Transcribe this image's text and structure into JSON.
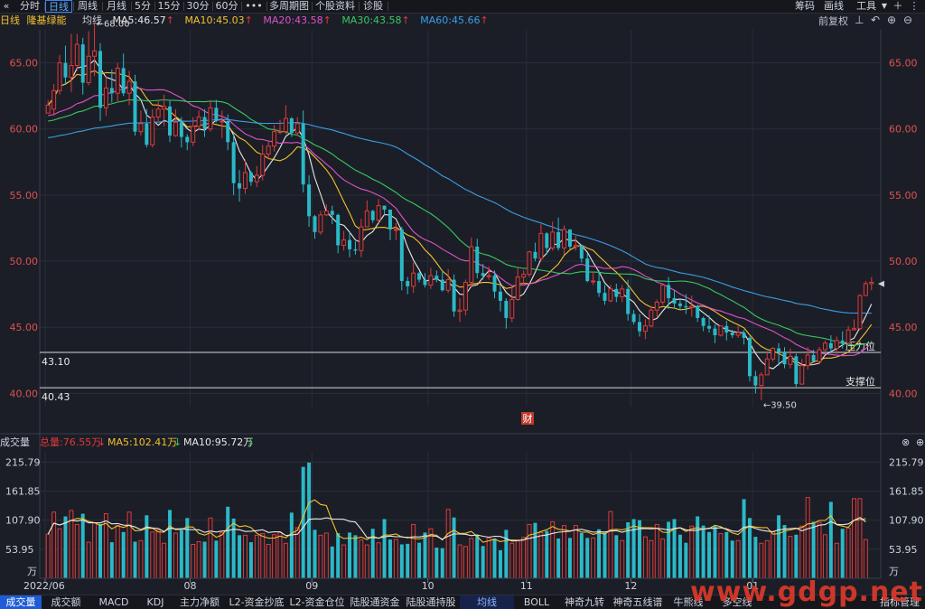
{
  "toolbar": {
    "back_icon": "«",
    "tabs": [
      "分时",
      "日线",
      "周线",
      "月线",
      "5分",
      "15分",
      "30分",
      "60分",
      "•••",
      "多周期图",
      "个股资料",
      "诊股"
    ],
    "active_tab": "日线",
    "right": [
      "筹码",
      "画线",
      "工具"
    ]
  },
  "ma_row": {
    "period": "日线",
    "stock": "隆基绿能",
    "label": "均线",
    "ma5": "MA5:46.57",
    "ma10": "MA10:45.03",
    "ma20": "MA20:43.58",
    "ma30": "MA30:43.58",
    "ma60": "MA60:45.66",
    "adjust": "前复权"
  },
  "colors": {
    "up": "#e03a3a",
    "down": "#2bb9c8",
    "ma5": "#e8e8e8",
    "ma10": "#f2c12e",
    "ma20": "#e052c8",
    "ma30": "#39c860",
    "ma60": "#3a9ee8",
    "bg": "#1b1e27"
  },
  "annotations": {
    "high": "68.00",
    "low": "39.50",
    "line1_value": "43.10",
    "line1_label": "压力位",
    "line2_value": "40.43",
    "line2_label": "支撑位",
    "fin_marker": "财"
  },
  "volume": {
    "title": "成交量",
    "total": "总量:76.55万",
    "ma5": "MA5:102.41万",
    "ma10": "MA10:95.72万",
    "y_ticks": [
      "215.79",
      "161.85",
      "107.90",
      "53.95",
      "万"
    ]
  },
  "bottom_tabs": [
    "成交量",
    "成交额",
    "MACD",
    "KDJ",
    "主力净额",
    "L2-资金抄底",
    "L2-资金仓位",
    "陆股通资金",
    "陆股通持股",
    "均线",
    "BOLL",
    "神奇九转",
    "神奇五线谱",
    "牛熊线",
    "多空线",
    "指标管理"
  ],
  "watermark": "www.gdgp.net",
  "chart_data": {
    "type": "candlestick",
    "price_axis": {
      "ticks": [
        40,
        45,
        50,
        55,
        60,
        65
      ],
      "tick_labels": [
        "40.00",
        "45.00",
        "50.00",
        "55.00",
        "60.00",
        "65.00"
      ],
      "ylim": [
        39.0,
        67.5
      ]
    },
    "x_labels": [
      "2022/06",
      "08",
      "09",
      "10",
      "11",
      "12",
      "01"
    ],
    "month_starts_index": [
      0,
      25,
      46,
      66,
      83,
      101,
      122
    ],
    "candles": [
      [
        61.2,
        61.8,
        61.5,
        62.2
      ],
      [
        61.5,
        62.9,
        61.0,
        63.4
      ],
      [
        62.9,
        65.0,
        62.6,
        65.6
      ],
      [
        65.0,
        63.9,
        63.4,
        66.3
      ],
      [
        63.9,
        64.8,
        62.8,
        67.2
      ],
      [
        64.8,
        66.4,
        64.4,
        67.2
      ],
      [
        66.4,
        63.5,
        62.6,
        66.9
      ],
      [
        63.5,
        65.5,
        63.3,
        67.4
      ],
      [
        65.5,
        65.9,
        64.0,
        68.0
      ],
      [
        65.9,
        61.6,
        60.6,
        66.5
      ],
      [
        61.6,
        63.1,
        61.0,
        64.0
      ],
      [
        63.1,
        62.7,
        62.0,
        64.5
      ],
      [
        62.7,
        64.6,
        62.1,
        65.0
      ],
      [
        64.6,
        62.7,
        62.5,
        65.7
      ],
      [
        62.7,
        63.6,
        61.8,
        64.4
      ],
      [
        63.6,
        59.8,
        59.5,
        64.1
      ],
      [
        59.8,
        60.4,
        59.5,
        61.4
      ],
      [
        60.4,
        58.8,
        58.6,
        61.5
      ],
      [
        58.8,
        60.9,
        58.6,
        61.5
      ],
      [
        60.9,
        61.5,
        60.6,
        62.1
      ],
      [
        61.5,
        61.7,
        60.2,
        62.6
      ],
      [
        61.7,
        59.5,
        59.0,
        62.2
      ],
      [
        59.5,
        60.5,
        59.4,
        61.5
      ],
      [
        60.5,
        59.4,
        58.6,
        60.9
      ],
      [
        59.4,
        59.0,
        58.4,
        59.6
      ],
      [
        59.0,
        60.2,
        58.7,
        60.9
      ],
      [
        60.2,
        60.9,
        59.9,
        61.4
      ],
      [
        60.9,
        60.0,
        59.4,
        61.5
      ],
      [
        60.0,
        61.6,
        59.8,
        62.2
      ],
      [
        61.6,
        60.6,
        60.5,
        62.2
      ],
      [
        60.6,
        60.6,
        59.3,
        61.4
      ],
      [
        60.6,
        59.0,
        58.4,
        61.1
      ],
      [
        59.0,
        55.9,
        55.0,
        59.7
      ],
      [
        55.9,
        55.5,
        54.5,
        56.9
      ],
      [
        55.5,
        56.7,
        55.1,
        57.7
      ],
      [
        56.7,
        56.0,
        55.7,
        56.8
      ],
      [
        56.0,
        56.5,
        55.6,
        57.2
      ],
      [
        56.5,
        58.1,
        56.1,
        58.8
      ],
      [
        58.1,
        58.7,
        57.7,
        59.1
      ],
      [
        58.7,
        59.8,
        58.3,
        60.3
      ],
      [
        59.8,
        59.8,
        59.6,
        60.7
      ],
      [
        59.8,
        60.8,
        59.6,
        61.8
      ],
      [
        60.8,
        59.7,
        59.4,
        60.9
      ],
      [
        59.7,
        60.4,
        59.5,
        60.9
      ],
      [
        60.4,
        55.8,
        55.2,
        61.4
      ],
      [
        55.8,
        53.4,
        52.6,
        56.5
      ],
      [
        53.4,
        52.2,
        51.7,
        53.5
      ],
      [
        52.2,
        53.5,
        52.0,
        53.8
      ],
      [
        53.5,
        53.8,
        53.4,
        54.3
      ],
      [
        53.8,
        53.5,
        52.8,
        54.2
      ],
      [
        53.5,
        51.2,
        50.6,
        53.6
      ],
      [
        51.2,
        51.6,
        50.8,
        52.3
      ],
      [
        51.6,
        50.9,
        50.3,
        52.2
      ],
      [
        50.9,
        50.8,
        50.5,
        51.5
      ],
      [
        50.8,
        52.6,
        50.3,
        53.2
      ],
      [
        52.6,
        53.8,
        52.6,
        54.6
      ],
      [
        53.8,
        53.1,
        52.9,
        53.9
      ],
      [
        53.1,
        54.2,
        52.9,
        54.7
      ],
      [
        54.2,
        53.9,
        53.5,
        54.2
      ],
      [
        53.9,
        52.4,
        51.6,
        53.9
      ],
      [
        52.4,
        52.4,
        51.6,
        52.9
      ],
      [
        52.4,
        48.5,
        47.8,
        52.6
      ],
      [
        48.5,
        48.1,
        47.5,
        48.8
      ],
      [
        48.1,
        49.1,
        47.6,
        49.9
      ],
      [
        49.1,
        48.6,
        48.4,
        49.2
      ],
      [
        48.6,
        48.2,
        48.0,
        49.1
      ],
      [
        48.2,
        48.9,
        47.9,
        49.5
      ],
      [
        48.9,
        48.6,
        48.4,
        49.3
      ],
      [
        48.6,
        47.8,
        47.7,
        49.2
      ],
      [
        47.8,
        48.6,
        47.6,
        49.4
      ],
      [
        48.6,
        46.2,
        45.8,
        49.0
      ],
      [
        46.2,
        46.3,
        45.4,
        47.2
      ],
      [
        46.3,
        48.4,
        45.9,
        48.6
      ],
      [
        48.4,
        51.1,
        48.0,
        51.8
      ],
      [
        51.1,
        49.1,
        48.7,
        51.7
      ],
      [
        49.1,
        48.9,
        48.6,
        49.8
      ],
      [
        48.9,
        48.9,
        48.6,
        49.6
      ],
      [
        48.9,
        47.7,
        47.2,
        49.3
      ],
      [
        47.7,
        47.0,
        46.2,
        48.2
      ],
      [
        47.0,
        45.7,
        44.9,
        47.2
      ],
      [
        45.7,
        47.1,
        45.4,
        48.1
      ],
      [
        47.1,
        48.8,
        47.0,
        49.5
      ],
      [
        48.8,
        49.0,
        48.2,
        49.3
      ],
      [
        49.0,
        50.7,
        48.8,
        50.8
      ],
      [
        50.7,
        50.2,
        50.0,
        51.4
      ],
      [
        50.2,
        52.1,
        50.0,
        52.8
      ],
      [
        52.1,
        51.0,
        50.5,
        52.2
      ],
      [
        51.0,
        52.2,
        50.8,
        53.0
      ],
      [
        52.2,
        51.0,
        50.8,
        53.3
      ],
      [
        51.0,
        52.4,
        50.5,
        52.7
      ],
      [
        52.4,
        51.1,
        50.9,
        52.4
      ],
      [
        51.1,
        51.2,
        50.8,
        51.9
      ],
      [
        51.2,
        50.2,
        49.9,
        51.2
      ],
      [
        50.2,
        48.5,
        48.4,
        50.6
      ],
      [
        48.5,
        48.5,
        48.2,
        49.2
      ],
      [
        48.5,
        47.6,
        47.3,
        49.3
      ],
      [
        47.6,
        47.0,
        46.7,
        48.2
      ],
      [
        47.0,
        47.9,
        46.9,
        48.2
      ],
      [
        47.9,
        47.3,
        46.9,
        48.3
      ],
      [
        47.3,
        47.9,
        46.9,
        48.2
      ],
      [
        47.9,
        46.0,
        45.5,
        48.6
      ],
      [
        46.0,
        45.4,
        45.2,
        46.3
      ],
      [
        45.4,
        44.7,
        44.3,
        46.0
      ],
      [
        44.7,
        45.1,
        44.1,
        45.6
      ],
      [
        45.1,
        46.3,
        45.0,
        46.6
      ],
      [
        46.3,
        46.9,
        45.8,
        47.1
      ],
      [
        46.9,
        48.2,
        46.7,
        48.2
      ],
      [
        48.2,
        47.2,
        46.4,
        48.8
      ],
      [
        47.2,
        46.8,
        46.4,
        47.8
      ],
      [
        46.8,
        46.6,
        46.3,
        47.2
      ],
      [
        46.6,
        46.5,
        46.0,
        47.5
      ],
      [
        46.5,
        46.6,
        45.8,
        47.4
      ],
      [
        46.6,
        45.7,
        45.4,
        46.7
      ],
      [
        45.7,
        45.1,
        44.7,
        45.8
      ],
      [
        45.1,
        44.9,
        44.6,
        45.9
      ],
      [
        44.9,
        44.4,
        43.8,
        45.2
      ],
      [
        44.4,
        45.1,
        44.3,
        45.1
      ],
      [
        45.1,
        44.6,
        44.0,
        45.5
      ],
      [
        44.6,
        44.4,
        44.2,
        44.8
      ],
      [
        44.4,
        44.6,
        44.2,
        45.1
      ],
      [
        44.6,
        44.2,
        43.7,
        44.8
      ],
      [
        44.2,
        41.3,
        40.9,
        44.3
      ],
      [
        41.3,
        40.6,
        40.0,
        41.7
      ],
      [
        40.6,
        41.4,
        39.5,
        41.6
      ],
      [
        41.4,
        42.6,
        41.4,
        43.1
      ],
      [
        42.6,
        43.4,
        42.4,
        43.5
      ],
      [
        43.4,
        43.1,
        42.1,
        43.8
      ],
      [
        43.1,
        42.2,
        41.9,
        43.5
      ],
      [
        42.2,
        42.8,
        41.9,
        43.4
      ],
      [
        42.8,
        40.7,
        40.5,
        43.0
      ],
      [
        40.7,
        42.1,
        40.7,
        42.6
      ],
      [
        42.1,
        42.9,
        41.8,
        43.5
      ],
      [
        42.9,
        42.4,
        42.4,
        43.3
      ],
      [
        42.4,
        43.3,
        42.2,
        43.5
      ],
      [
        43.3,
        43.8,
        43.2,
        44.0
      ],
      [
        43.8,
        43.4,
        43.1,
        44.4
      ],
      [
        43.4,
        44.0,
        43.0,
        44.3
      ],
      [
        44.0,
        43.8,
        43.4,
        44.7
      ],
      [
        43.8,
        44.8,
        43.8,
        45.1
      ],
      [
        44.8,
        44.9,
        44.8,
        45.6
      ],
      [
        44.9,
        47.4,
        44.8,
        47.5
      ],
      [
        47.4,
        48.3,
        47.4,
        48.5
      ],
      [
        48.3,
        48.4,
        47.8,
        48.8
      ]
    ],
    "volumes": [
      82,
      123,
      92,
      115,
      126,
      100,
      120,
      67,
      103,
      101,
      120,
      67,
      98,
      86,
      123,
      68,
      70,
      117,
      86,
      90,
      65,
      127,
      84,
      90,
      112,
      63,
      68,
      68,
      112,
      70,
      85,
      133,
      111,
      80,
      80,
      67,
      80,
      83,
      63,
      81,
      85,
      65,
      122,
      94,
      207,
      215,
      90,
      80,
      84,
      59,
      84,
      62,
      85,
      80,
      71,
      62,
      92,
      66,
      110,
      72,
      72,
      63,
      64,
      100,
      66,
      85,
      92,
      57,
      56,
      128,
      113,
      62,
      59,
      74,
      80,
      60,
      75,
      74,
      52,
      90,
      65,
      71,
      76,
      100,
      103,
      85,
      88,
      105,
      74,
      98,
      75,
      98,
      84,
      75,
      75,
      91,
      85,
      124,
      80,
      70,
      104,
      110,
      108,
      77,
      70,
      100,
      73,
      105,
      110,
      81,
      66,
      97,
      115,
      98,
      86,
      97,
      83,
      86,
      70,
      70,
      147,
      112,
      77,
      65,
      70,
      86,
      117,
      99,
      78,
      81,
      97,
      150,
      105,
      104,
      81,
      142,
      65,
      92,
      93,
      148,
      148,
      72
    ],
    "volume_axis": {
      "ticks": [
        53.95,
        107.9,
        161.85,
        215.79
      ],
      "ylim": [
        0,
        225
      ]
    },
    "ma_series": [
      "MA5",
      "MA10",
      "MA20",
      "MA30",
      "MA60"
    ]
  }
}
